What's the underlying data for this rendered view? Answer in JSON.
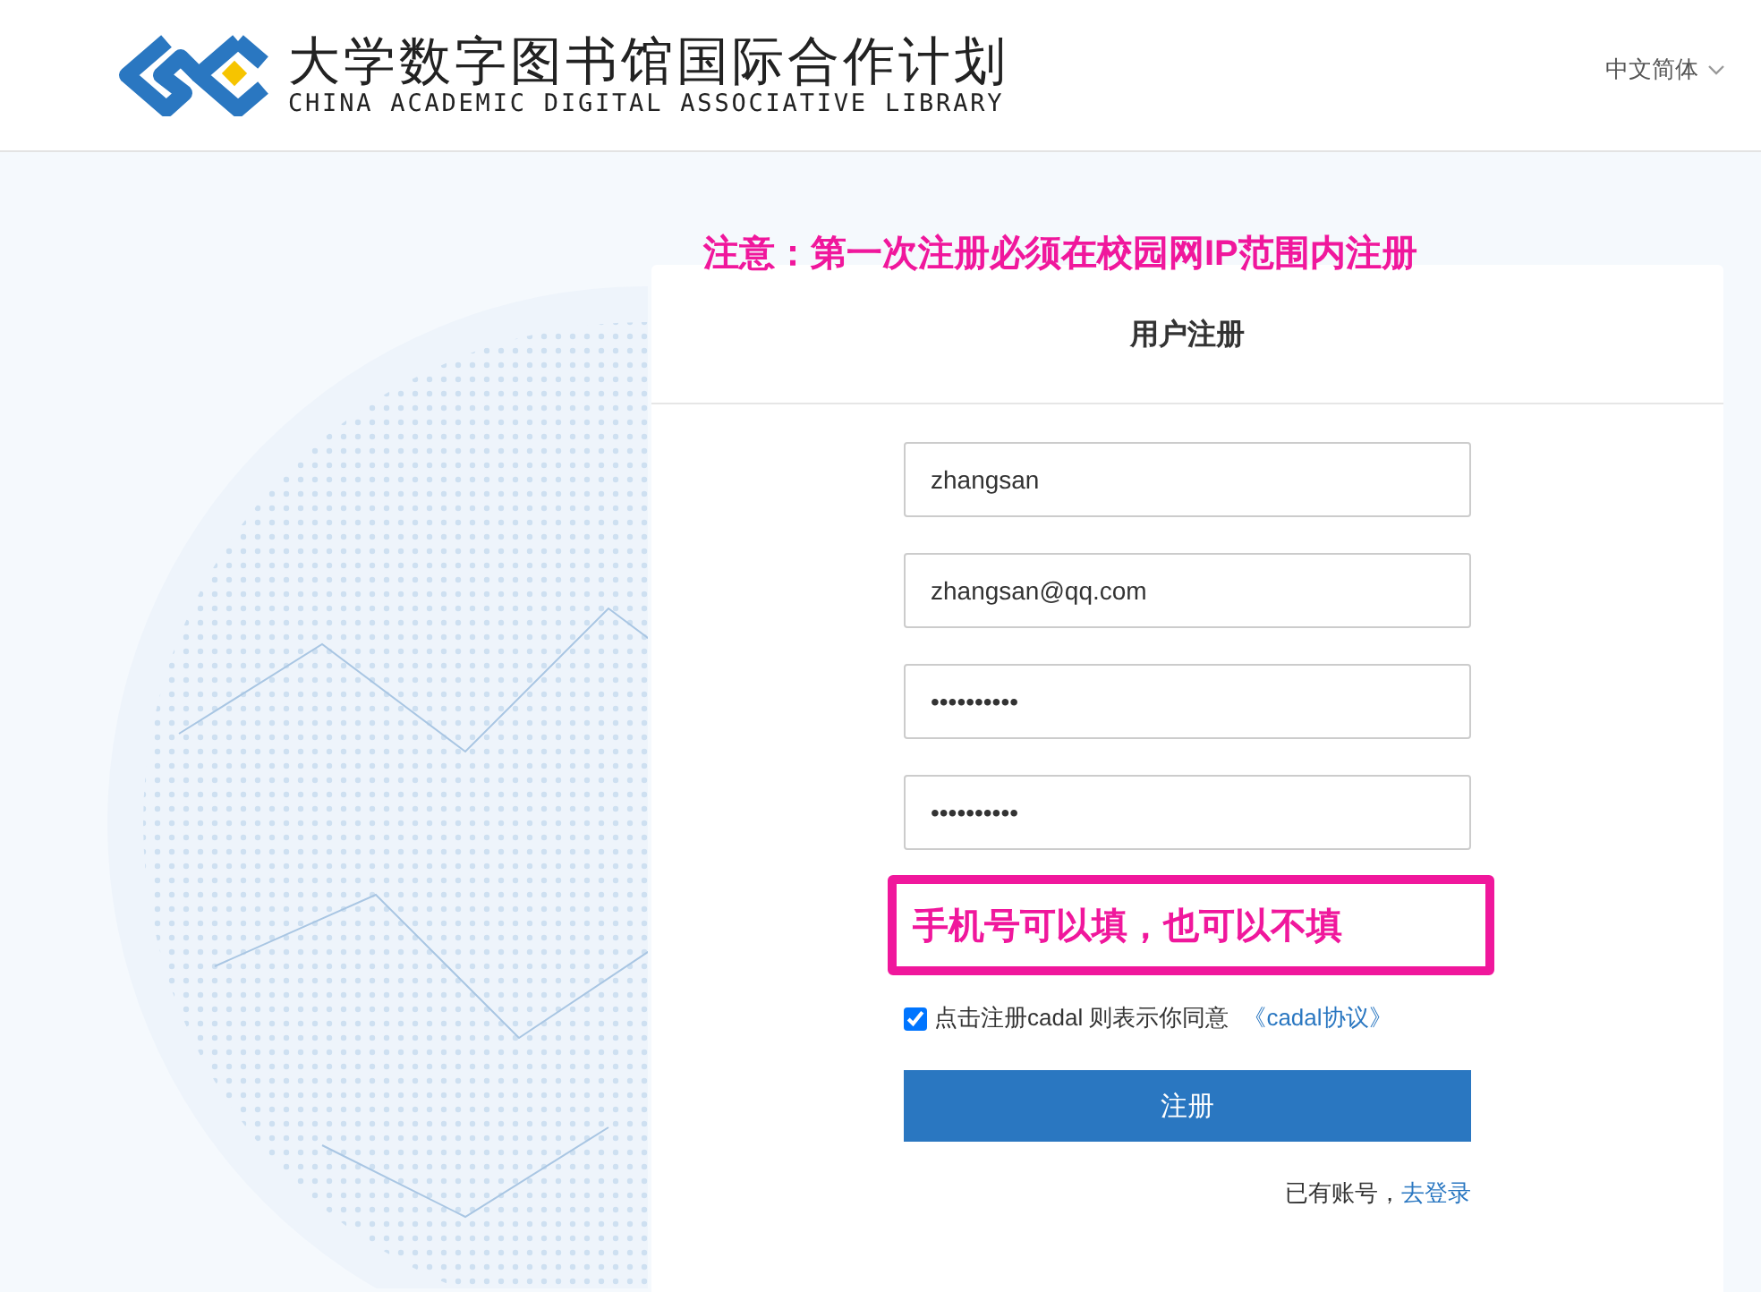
{
  "header": {
    "logo_title": "大学数字图书馆国际合作计划",
    "logo_subtitle": "CHINA ACADEMIC DIGITAL ASSOCIATIVE LIBRARY",
    "language": "中文简体"
  },
  "notice": "注意：第一次注册必须在校园网IP范围内注册",
  "form": {
    "title": "用户注册",
    "fields": [
      {
        "kind": "text",
        "value": "zhangsan"
      },
      {
        "kind": "text",
        "value": "zhangsan@qq.com"
      },
      {
        "kind": "password",
        "value": "••••••••••"
      },
      {
        "kind": "password",
        "value": "••••••••••"
      },
      {
        "kind": "annotation",
        "value": "手机号可以填，也可以不填"
      }
    ],
    "agreement": {
      "checked": true,
      "text": "点击注册cadal 则表示你同意",
      "link": "《cadal协议》"
    },
    "submit": "注册",
    "login_prompt": {
      "text": "已有账号，",
      "link": "去登录"
    }
  }
}
